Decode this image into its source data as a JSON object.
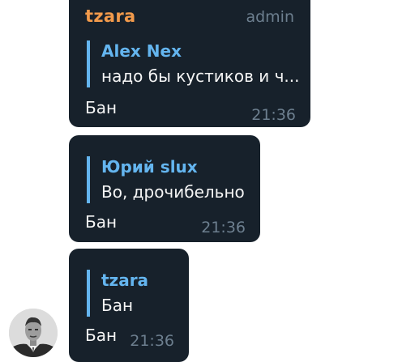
{
  "messages": [
    {
      "sender": "tzara",
      "role": "admin",
      "reply_author": "Alex Nex",
      "reply_text": "надо бы кустиков и ч...",
      "text": "Бан",
      "time": "21:36"
    },
    {
      "reply_author": "Юрий slux",
      "reply_text": "Во, дрочибельно",
      "text": "Бан",
      "time": "21:36"
    },
    {
      "reply_author": "tzara",
      "reply_text": "Бан",
      "text": "Бан",
      "time": "21:36"
    }
  ],
  "colors": {
    "bubble_bg": "#17212b",
    "sender_name": "#f29a4b",
    "reply_accent": "#64b5ef",
    "meta_text": "#6d7f8f",
    "message_text": "#f5f5f5"
  },
  "avatar_icon": "user-photo-avatar"
}
